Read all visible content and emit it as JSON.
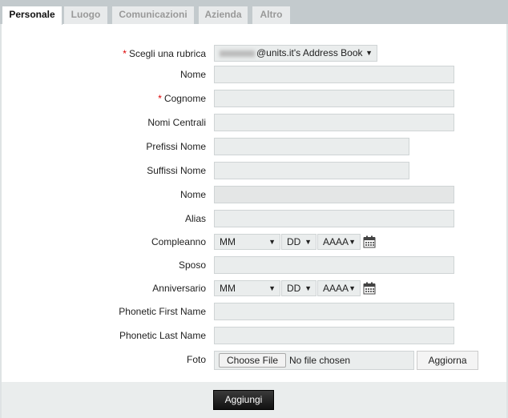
{
  "tabs": [
    {
      "label": "Personale",
      "active": true
    },
    {
      "label": "Luogo"
    },
    {
      "label": "Comunicazioni"
    },
    {
      "label": "Azienda"
    },
    {
      "label": "Altro"
    }
  ],
  "address_book": {
    "label": "Scegli una rubrica",
    "required": true,
    "value": "@units.it's Address Book"
  },
  "fields": [
    {
      "label": "Nome",
      "required": false
    },
    {
      "label": "Cognome",
      "required": true
    },
    {
      "label": "Nomi Centrali",
      "required": false
    },
    {
      "label": "Prefissi Nome",
      "required": false
    },
    {
      "label": "Suffissi Nome",
      "required": false
    },
    {
      "label": "Nome",
      "required": false,
      "disabled": true
    },
    {
      "label": "Alias",
      "required": false
    },
    {
      "label": "Compleanno",
      "type": "date"
    },
    {
      "label": "Sposo"
    },
    {
      "label": "Anniversario",
      "type": "date"
    },
    {
      "label": "Phonetic First Name"
    },
    {
      "label": "Phonetic Last Name"
    },
    {
      "label": "Foto",
      "type": "file"
    }
  ],
  "date": {
    "month": "MM",
    "day": "DD",
    "year": "AAAA"
  },
  "file": {
    "choose": "Choose File",
    "status": "No file chosen",
    "refresh": "Aggiorna"
  },
  "submit": "Aggiungi",
  "icons": {
    "calendar": "calendar-icon",
    "dropdown": "caret-down-icon"
  }
}
